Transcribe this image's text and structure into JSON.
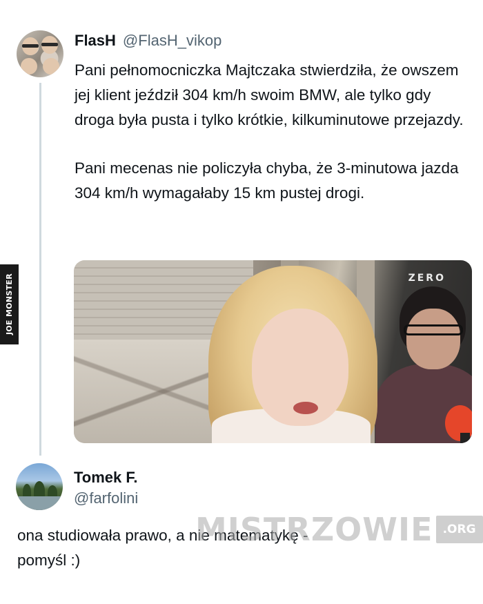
{
  "tweet": {
    "author_name": "FlasH",
    "author_handle": "@FlasH_vikop",
    "paragraphs": [
      "Pani pełnomocniczka Majtczaka stwierdziła, że owszem jej klient jeździł 304 km/h swoim BMW, ale tylko gdy droga była pusta i tylko krótkie, kilkuminutowe przejazdy.",
      "Pani mecenas nie policzyła chyba, że 3-minutowa jazda 304 km/h wymagałaby 15 km pustej drogi."
    ],
    "media_logo": "ZERO"
  },
  "reply": {
    "author_name": "Tomek F.",
    "author_handle": "@farfolini",
    "lines": [
      "ona studiowała prawo, a nie matematykę -",
      "pomyśl :)"
    ]
  },
  "watermarks": {
    "side": "JOE MONSTER",
    "site_name": "MISTRZOWIE",
    "site_tld": ".ORG"
  }
}
